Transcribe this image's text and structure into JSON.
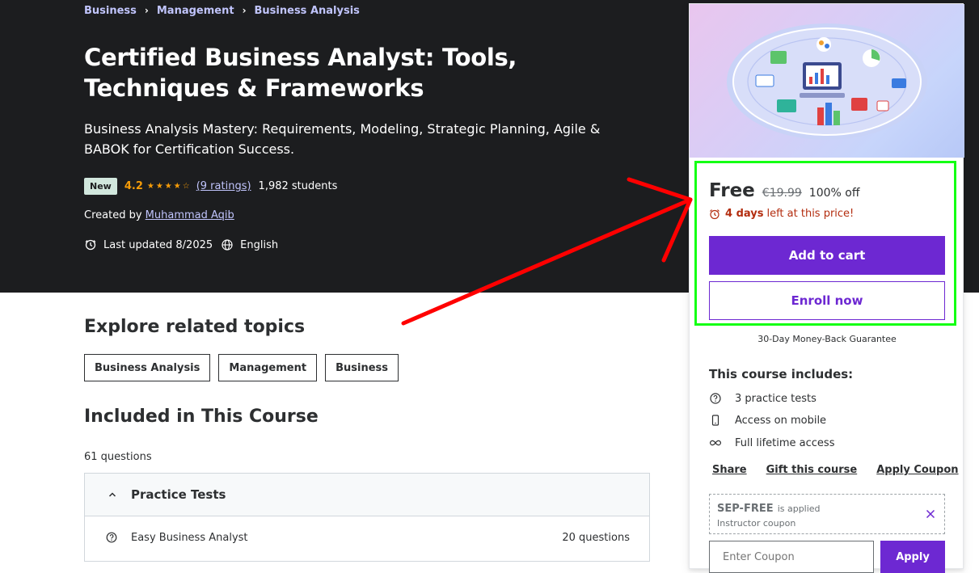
{
  "breadcrumb": [
    "Business",
    "Management",
    "Business Analysis"
  ],
  "course": {
    "title": "Certified Business Analyst: Tools, Techniques & Frameworks",
    "subtitle": "Business Analysis Mastery: Requirements, Modeling, Strategic Planning, Agile & BABOK for Certification Success.",
    "badge": "New",
    "rating": "4.2",
    "rating_stars": 4.2,
    "ratings_count": "(9 ratings)",
    "students": "1,982 students",
    "created_by_label": "Created by",
    "instructor": "Muhammad Aqib",
    "last_updated": "Last updated 8/2025",
    "language": "English"
  },
  "related": {
    "heading": "Explore related topics",
    "topics": [
      "Business Analysis",
      "Management",
      "Business"
    ]
  },
  "included": {
    "heading": "Included in This Course",
    "question_count": "61 questions",
    "section_title": "Practice Tests",
    "items": [
      {
        "label": "Easy Business Analyst",
        "count": "20 questions"
      }
    ]
  },
  "sidebar": {
    "price": "Free",
    "original_price": "€19.99",
    "discount": "100% off",
    "timer_bold": "4 days",
    "timer_rest": "left at this price!",
    "add_to_cart": "Add to cart",
    "enroll_now": "Enroll now",
    "guarantee": "30-Day Money-Back Guarantee",
    "includes_title": "This course includes:",
    "includes": [
      {
        "icon": "question-circle-icon",
        "label": "3 practice tests"
      },
      {
        "icon": "mobile-phone-icon",
        "label": "Access on mobile"
      },
      {
        "icon": "infinity-icon",
        "label": "Full lifetime access"
      }
    ],
    "share": "Share",
    "gift": "Gift this course",
    "apply_coupon": "Apply Coupon",
    "coupon_code": "SEP-FREE",
    "coupon_applied": "is applied",
    "coupon_type": "Instructor coupon",
    "coupon_placeholder": "Enter Coupon",
    "apply": "Apply"
  },
  "colors": {
    "hero_bg": "#1c1d1f",
    "accent": "#6d28d2",
    "link": "#c0c4fc",
    "star": "#f69c08",
    "timer": "#b32d0f",
    "highlight_box": "#14ff14",
    "arrow": "#ff0000"
  }
}
